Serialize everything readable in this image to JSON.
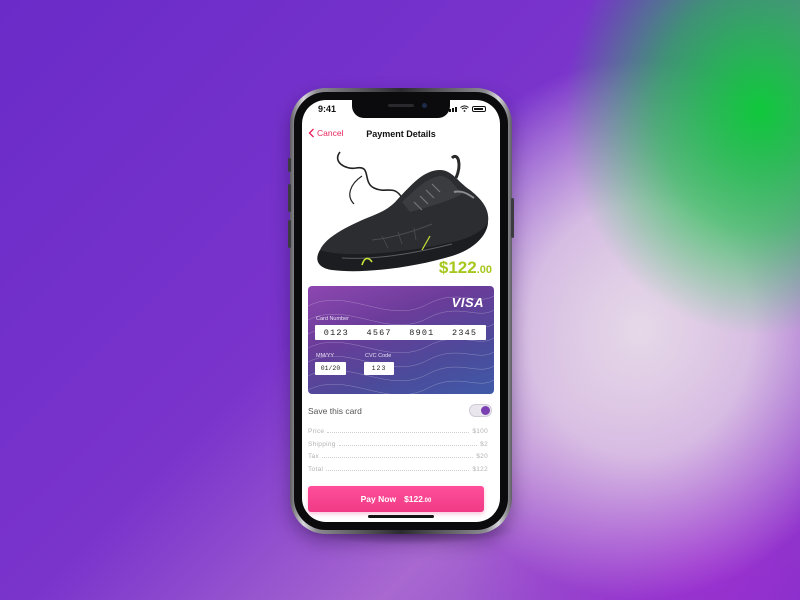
{
  "status_bar": {
    "time": "9:41"
  },
  "nav": {
    "back_label": "Cancel",
    "title": "Payment Details"
  },
  "product": {
    "price_main": "$122",
    "price_cents": ".00"
  },
  "card": {
    "brand": "VISA",
    "number_label": "Card Number",
    "number_groups": [
      "0123",
      "4567",
      "8901",
      "2345"
    ],
    "expiry_label": "MM/YY",
    "expiry_value": "01/20",
    "cvc_label": "CVC Code",
    "cvc_value": "123"
  },
  "save_card": {
    "label": "Save this card",
    "enabled": true
  },
  "summary": [
    {
      "label": "Price",
      "value": "$100"
    },
    {
      "label": "Shipping",
      "value": "$2"
    },
    {
      "label": "Tax",
      "value": "$20"
    },
    {
      "label": "Total",
      "value": "$122"
    }
  ],
  "pay_button": {
    "label": "Pay Now",
    "amount_main": "$122",
    "amount_cents": ".00"
  },
  "colors": {
    "accent": "#e8265e",
    "price": "#a6c81e",
    "button": "#f03a86",
    "toggle": "#7a3fb0"
  },
  "icons": [
    "chevron-left-icon",
    "signal-icon",
    "wifi-icon",
    "battery-icon",
    "sneaker-image"
  ]
}
